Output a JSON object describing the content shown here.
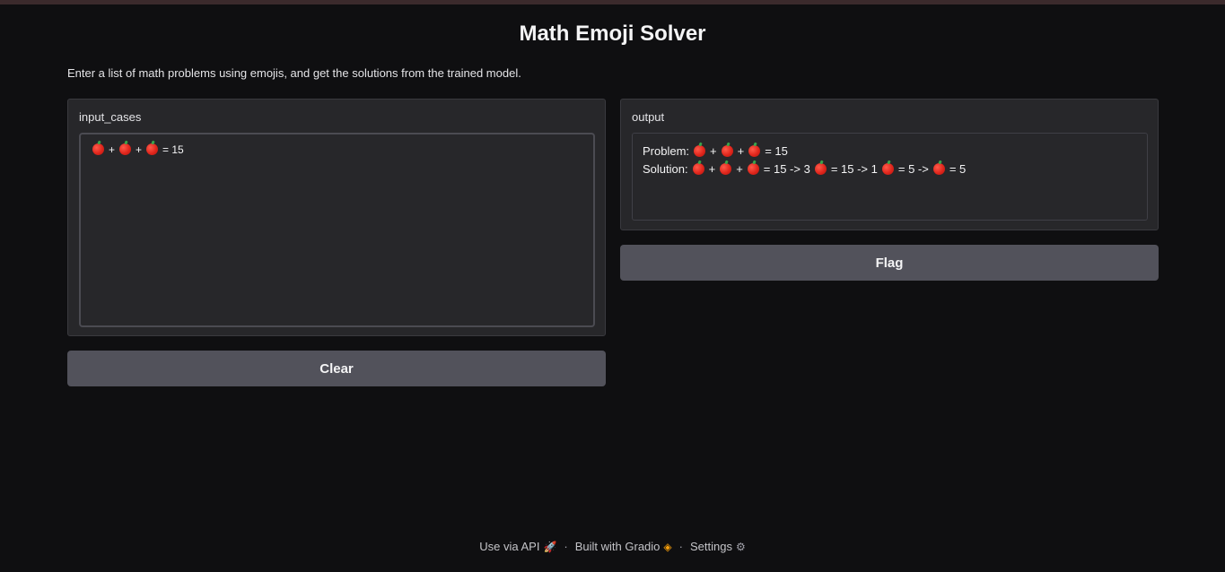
{
  "app": {
    "title": "Math Emoji Solver",
    "description": "Enter a list of math problems using emojis, and get the solutions from the trained model."
  },
  "input": {
    "label": "input_cases",
    "value_parts": [
      "apple",
      "+",
      "apple",
      "+",
      "apple",
      "= 15"
    ]
  },
  "output": {
    "label": "output",
    "problem_parts": [
      "Problem:",
      "apple",
      "+",
      "apple",
      "+",
      "apple",
      "= 15"
    ],
    "solution_parts": [
      "Solution:",
      "apple",
      "+",
      "apple",
      "+",
      "apple",
      "= 15 -> 3",
      "apple",
      "= 15 -> 1",
      "apple",
      "= 5 ->",
      "apple",
      "= 5"
    ]
  },
  "buttons": {
    "clear_label": "Clear",
    "flag_label": "Flag"
  },
  "footer": {
    "api_label": "Use via API",
    "api_icon": "rocket-icon",
    "separator": "·",
    "built_label": "Built with Gradio",
    "built_icon": "gradio-logo-icon",
    "settings_label": "Settings",
    "settings_icon": "gear-icon"
  },
  "colors": {
    "background": "#0f0f11",
    "panel": "#27272a",
    "button": "#52525b",
    "emoji_apple": "#e0261c"
  }
}
